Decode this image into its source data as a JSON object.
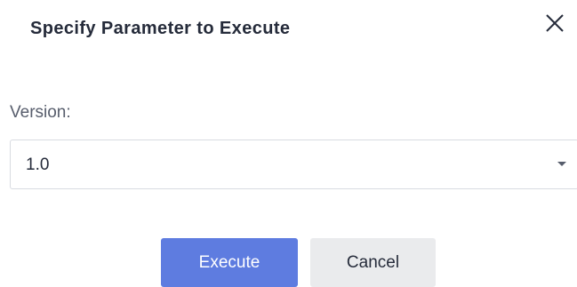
{
  "dialog": {
    "title": "Specify Parameter to Execute",
    "close_icon": "close-icon"
  },
  "form": {
    "version_label": "Version:",
    "version_value": "1.0",
    "dropdown_icon": "caret-down-icon"
  },
  "buttons": {
    "execute_label": "Execute",
    "cancel_label": "Cancel"
  },
  "colors": {
    "primary": "#5e7ce0",
    "cancel_bg": "#eaebed",
    "title_text": "#252b3a",
    "label_text": "#575d6c",
    "border": "#d8dbe1"
  }
}
